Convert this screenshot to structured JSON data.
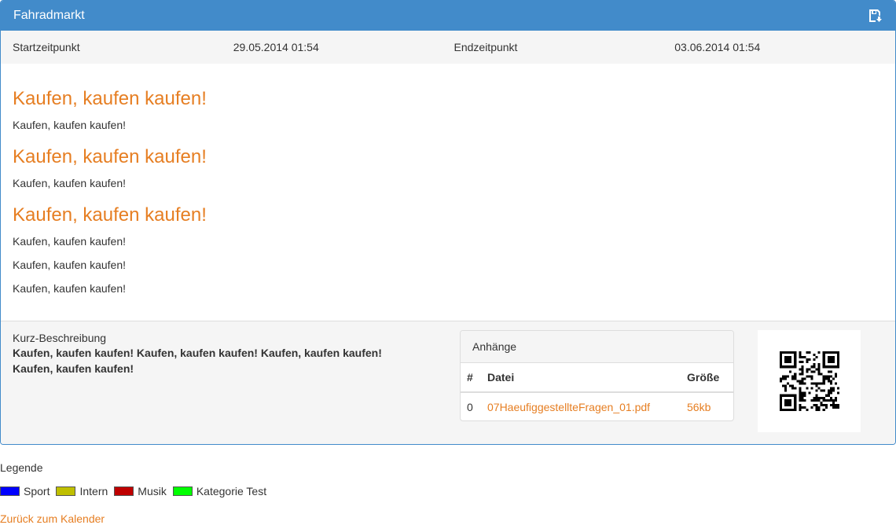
{
  "panel": {
    "title": "Fahradmarkt",
    "save_icon": "save-icon"
  },
  "times": {
    "start_label": "Startzeitpunkt",
    "start_value": "29.05.2014 01:54",
    "end_label": "Endzeitpunkt",
    "end_value": "03.06.2014 01:54"
  },
  "content": {
    "blocks": [
      {
        "heading": "Kaufen, kaufen kaufen!",
        "text": "Kaufen, kaufen kaufen!"
      },
      {
        "heading": "Kaufen, kaufen kaufen!",
        "text": "Kaufen, kaufen kaufen!"
      },
      {
        "heading": "Kaufen, kaufen kaufen!",
        "text": "Kaufen, kaufen kaufen!"
      }
    ],
    "extra_lines": [
      "Kaufen, kaufen kaufen!",
      "Kaufen, kaufen kaufen!"
    ]
  },
  "summary": {
    "label": "Kurz-Beschreibung",
    "text": "Kaufen, kaufen kaufen! Kaufen, kaufen kaufen! Kaufen, kaufen kaufen! Kaufen, kaufen kaufen!"
  },
  "attachments": {
    "title": "Anhänge",
    "columns": [
      "#",
      "Datei",
      "Größe"
    ],
    "rows": [
      {
        "index": "0",
        "file": "07HaeufiggestellteFragen_01.pdf",
        "size": "56kb"
      }
    ]
  },
  "qr_icon": "qr-code",
  "legend": {
    "title": "Legende",
    "items": [
      {
        "label": "Sport",
        "color": "#0000ff"
      },
      {
        "label": "Intern",
        "color": "#bfbf00"
      },
      {
        "label": "Musik",
        "color": "#bf0000"
      },
      {
        "label": "Kategorie Test",
        "color": "#00ff00"
      }
    ]
  },
  "back_link": "Zurück zum Kalender"
}
